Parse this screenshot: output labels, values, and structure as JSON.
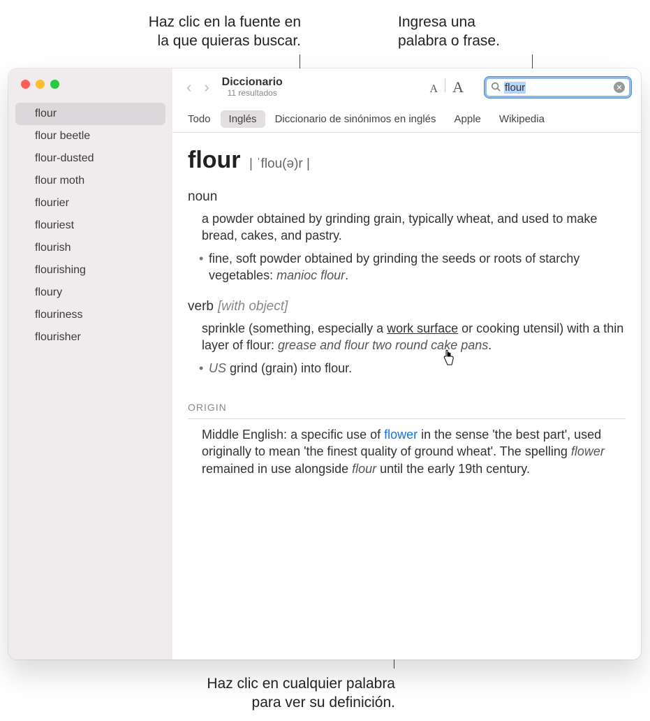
{
  "annotations": {
    "source": "Haz clic en la fuente en\nla que quieras buscar.",
    "search": "Ingresa una\npalabra o frase.",
    "clickword": "Haz clic en cualquier palabra\npara ver su definición."
  },
  "sidebar": {
    "items": [
      {
        "label": "flour",
        "selected": true
      },
      {
        "label": "flour beetle"
      },
      {
        "label": "flour-dusted"
      },
      {
        "label": "flour moth"
      },
      {
        "label": "flourier"
      },
      {
        "label": "flouriest"
      },
      {
        "label": "flourish"
      },
      {
        "label": "flourishing"
      },
      {
        "label": "floury"
      },
      {
        "label": "flouriness"
      },
      {
        "label": "flourisher"
      }
    ]
  },
  "toolbar": {
    "title": "Diccionario",
    "subtitle": "11 resultados",
    "font_small": "A",
    "font_large": "A",
    "search_value": "flour"
  },
  "tabs": [
    {
      "label": "Todo"
    },
    {
      "label": "Inglés",
      "active": true
    },
    {
      "label": "Diccionario de sinónimos en inglés"
    },
    {
      "label": "Apple"
    },
    {
      "label": "Wikipedia"
    }
  ],
  "entry": {
    "word": "flour",
    "pron": "| ˈflou(ə)r |",
    "noun_label": "noun",
    "noun_def": "a powder obtained by grinding grain, typically wheat, and used to make bread, cakes, and pastry.",
    "noun_sub_pre": "fine, soft powder obtained by grinding the seeds or roots of starchy vegetables: ",
    "noun_sub_ex": "manioc flour",
    "noun_sub_post": ".",
    "verb_label": "verb",
    "verb_qual": "[with object]",
    "verb_def_pre": "sprinkle (something, especially a ",
    "verb_def_ul": "work surface",
    "verb_def_mid": " or cooking utensil) with a thin layer of flour: ",
    "verb_def_ex": "grease and flour two round cake pans",
    "verb_def_post": ".",
    "verb_sub_region": "US",
    "verb_sub": " grind (grain) into flour.",
    "origin_hdr": "ORIGIN",
    "origin_pre": "Middle English: a specific use of ",
    "origin_link": "flower",
    "origin_mid": " in the sense 'the best part', used originally to mean 'the finest quality of ground wheat'. The spelling ",
    "origin_it1": "flower",
    "origin_mid2": " remained in use alongside ",
    "origin_it2": "flour",
    "origin_end": " until the early 19th century."
  }
}
